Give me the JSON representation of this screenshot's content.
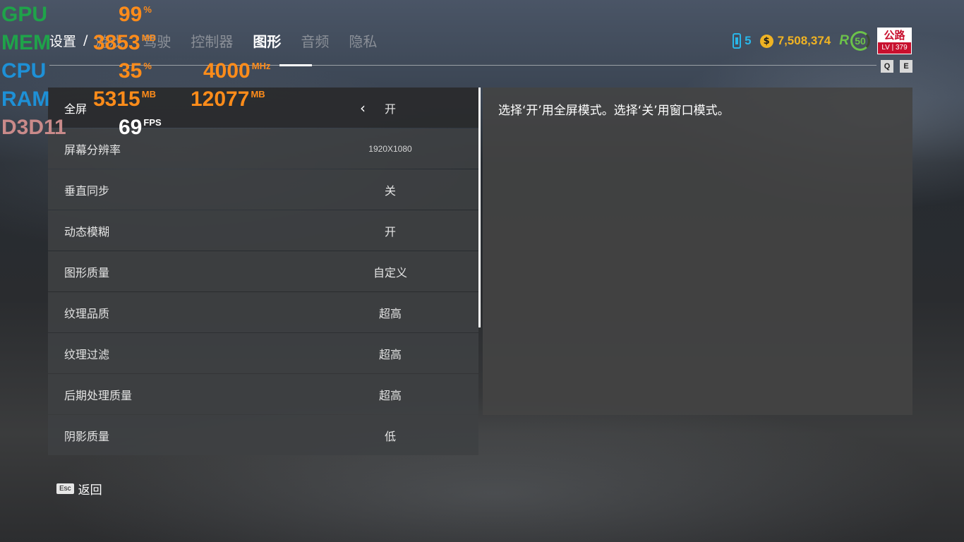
{
  "nav": {
    "breadcrumb": "设置",
    "separator": "/",
    "tabs": [
      "游戏",
      "驾驶",
      "控制器",
      "图形",
      "音频",
      "隐私"
    ],
    "active_tab": "图形"
  },
  "status": {
    "phone_count": "5",
    "coin_symbol": "$",
    "credits": "7,508,374",
    "rank_logo": "R",
    "level": "50",
    "badge_top": "公路",
    "badge_bottom": "LV | 379",
    "key_q": "Q",
    "key_e": "E"
  },
  "settings": [
    {
      "label": "全屏",
      "value": "开",
      "selected": true
    },
    {
      "label": "屏幕分辨率",
      "value": "1920X1080"
    },
    {
      "label": "垂直同步",
      "value": "关"
    },
    {
      "label": "动态模糊",
      "value": "开"
    },
    {
      "label": "图形质量",
      "value": "自定义"
    },
    {
      "label": "纹理品质",
      "value": "超高"
    },
    {
      "label": "纹理过滤",
      "value": "超高"
    },
    {
      "label": "后期处理质量",
      "value": "超高"
    },
    {
      "label": "阴影质量",
      "value": "低"
    }
  ],
  "selected_chevron": "‹",
  "description": "选择‘开’用全屏模式。选择‘关’用窗口模式。",
  "back": {
    "key": "Esc",
    "label": "返回"
  },
  "overlay": {
    "gpu_label": "GPU",
    "gpu_value": "99",
    "gpu_unit": "%",
    "mem_label": "MEM",
    "mem_value": "3853",
    "mem_unit": "MB",
    "cpu_label": "CPU",
    "cpu_value": "35",
    "cpu_unit": "%",
    "cpu_clock": "4000",
    "cpu_clock_unit": "MHz",
    "ram_label": "RAM",
    "ram_value": "5315",
    "ram_unit": "MB",
    "ram_total": "12077",
    "ram_total_unit": "MB",
    "api_label": "D3D11",
    "fps_value": "69",
    "fps_unit": "FPS",
    "colors": {
      "gpu": "#1fa34a",
      "mem": "#1fa34a",
      "cpu": "#1e90d6",
      "ram": "#1e90d6",
      "api": "#c98a8a",
      "value": "#ff8c1a"
    }
  }
}
